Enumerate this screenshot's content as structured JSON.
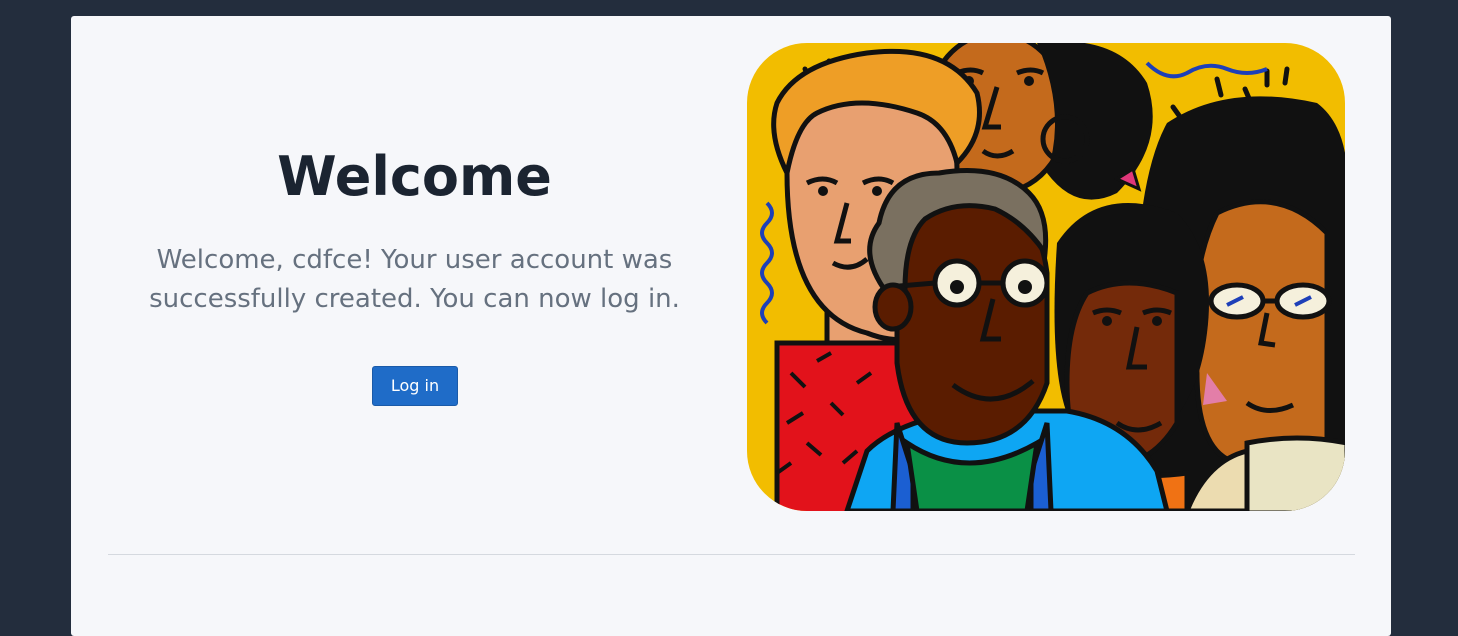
{
  "welcome": {
    "title": "Welcome",
    "message": "Welcome, cdfce! Your user account was successfully created. You can now log in.",
    "login_label": "Log in"
  },
  "colors": {
    "page_background": "#232d3d",
    "card_background": "#f6f7fa",
    "title_text": "#1b2431",
    "message_text": "#66717f",
    "button_background": "#1f6cc8",
    "illustration_background": "#f2bd00"
  },
  "illustration": {
    "icon": "diverse-people-illustration"
  }
}
